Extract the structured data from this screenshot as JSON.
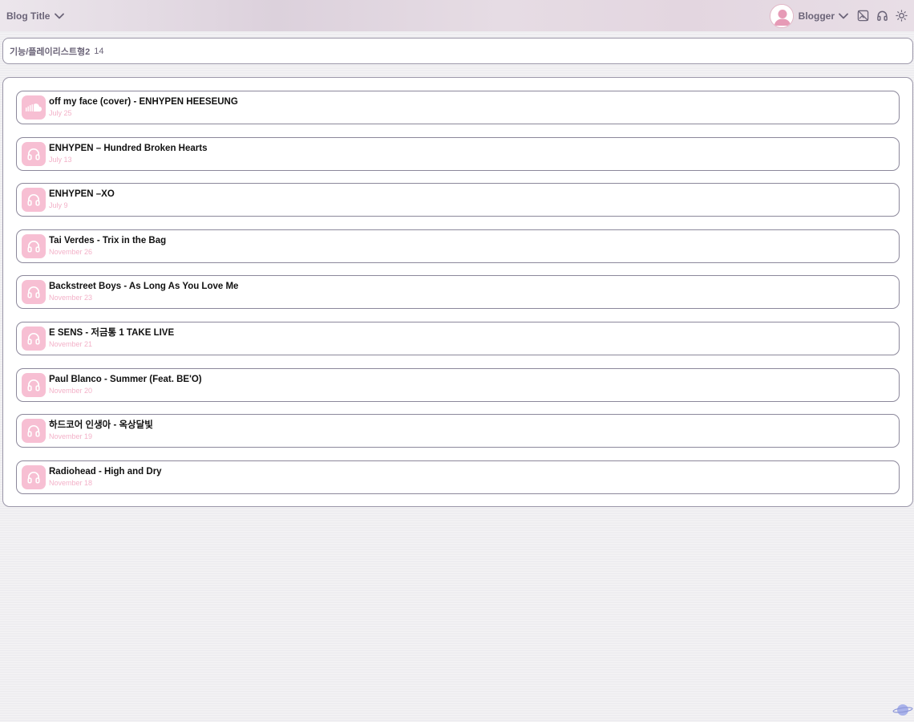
{
  "header": {
    "blog_title": "Blog Title",
    "user_name": "Blogger",
    "icons": [
      "chevron-down-icon",
      "user-avatar-icon",
      "no-image-icon",
      "headphones-icon",
      "sun-icon"
    ]
  },
  "breadcrumb": {
    "path": "기능/플레이리스트형2",
    "count": "14"
  },
  "colors": {
    "accent_pink": "#f7bfd3",
    "date_pink": "#f3b1c8",
    "muted_text": "#6b6478",
    "border": "#8c889b"
  },
  "playlist": {
    "items": [
      {
        "title": "off my face (cover) - ENHYPEN HEESEUNG",
        "date": "July 25",
        "icon": "soundcloud-icon"
      },
      {
        "title": "ENHYPEN – Hundred Broken Hearts",
        "date": "July 13",
        "icon": "headphones-icon"
      },
      {
        "title": "ENHYPEN –XO",
        "date": "July 9",
        "icon": "headphones-icon"
      },
      {
        "title": "Tai Verdes - Trix in the Bag",
        "date": "November 26",
        "icon": "headphones-icon"
      },
      {
        "title": "Backstreet Boys - As Long As You Love Me",
        "date": "November 23",
        "icon": "headphones-icon"
      },
      {
        "title": "E SENS - 저금통 1 TAKE LIVE",
        "date": "November 21",
        "icon": "headphones-icon"
      },
      {
        "title": "Paul Blanco - Summer (Feat. BE'O)",
        "date": "November 20",
        "icon": "headphones-icon"
      },
      {
        "title": "하드코어 인생아 - 옥상달빛",
        "date": "November 19",
        "icon": "headphones-icon"
      },
      {
        "title": "Radiohead - High and Dry",
        "date": "November 18",
        "icon": "headphones-icon"
      }
    ]
  }
}
